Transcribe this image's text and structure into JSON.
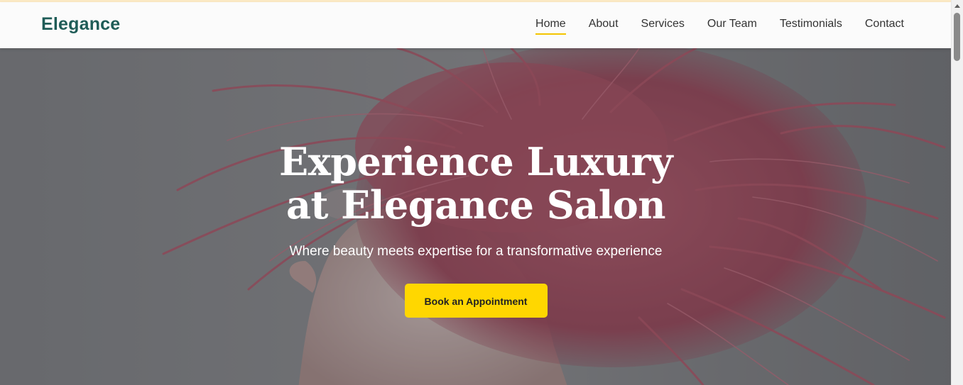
{
  "header": {
    "logo": "Elegance",
    "nav": [
      {
        "label": "Home",
        "active": true
      },
      {
        "label": "About",
        "active": false
      },
      {
        "label": "Services",
        "active": false
      },
      {
        "label": "Our Team",
        "active": false
      },
      {
        "label": "Testimonials",
        "active": false
      },
      {
        "label": "Contact",
        "active": false
      }
    ]
  },
  "hero": {
    "title": "Experience Luxury at Elegance Salon",
    "subtitle": "Where beauty meets expertise for a transformative experience",
    "cta_label": "Book an Appointment",
    "background": "woman with flowing pink hair",
    "colors": {
      "accent": "#ffd700",
      "brand": "#1f5c57",
      "hair": "#c0566a"
    }
  }
}
